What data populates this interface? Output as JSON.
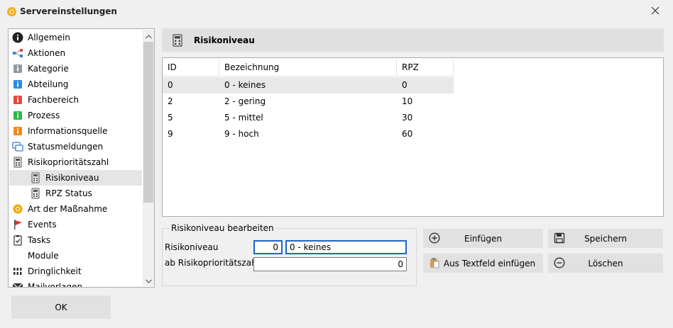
{
  "window": {
    "title": "Servereinstellungen"
  },
  "nav": {
    "items": [
      {
        "label": "Allgemein",
        "icon": "info-circle-icon",
        "color": "#222222"
      },
      {
        "label": "Aktionen",
        "icon": "workflow-icon",
        "color": "#3b7dd8"
      },
      {
        "label": "Kategorie",
        "icon": "info-tag-icon",
        "color": "#8c9aa3"
      },
      {
        "label": "Abteilung",
        "icon": "info-tag-icon",
        "color": "#2f8be0"
      },
      {
        "label": "Fachbereich",
        "icon": "info-tag-icon",
        "color": "#e5483c"
      },
      {
        "label": "Prozess",
        "icon": "info-tag-icon",
        "color": "#2eb84b"
      },
      {
        "label": "Informationsquelle",
        "icon": "info-tag-icon",
        "color": "#f08a1c"
      },
      {
        "label": "Statusmeldungen",
        "icon": "chat-bubbles-icon",
        "color": "#3b7dd8"
      },
      {
        "label": "Risikoprioritätszahl",
        "icon": "calculator-icon",
        "color": "#555555"
      },
      {
        "label": "Risikoniveau",
        "icon": "calculator-icon",
        "color": "#555555"
      },
      {
        "label": "RPZ Status",
        "icon": "calculator-icon",
        "color": "#555555"
      },
      {
        "label": "Art der Maßnahme",
        "icon": "gear-sun-icon",
        "color": "#f2a900"
      },
      {
        "label": "Events",
        "icon": "flag-icon",
        "color": "#e03030"
      },
      {
        "label": "Tasks",
        "icon": "clipboard-check-icon",
        "color": "#333333"
      },
      {
        "label": "Module",
        "icon": "",
        "color": ""
      },
      {
        "label": "Dringlichkeit",
        "icon": "binary-icon",
        "color": "#333333"
      },
      {
        "label": "Mailvorlagen",
        "icon": "envelope-icon",
        "color": "#333333"
      }
    ]
  },
  "panel": {
    "title": "Risikoniveau"
  },
  "table": {
    "columns": [
      "ID",
      "Bezeichnung",
      "RPZ"
    ],
    "rows": [
      {
        "id": "0",
        "name": "0 - keines",
        "rpz": "0"
      },
      {
        "id": "2",
        "name": "2 - gering",
        "rpz": "10"
      },
      {
        "id": "5",
        "name": "5 - mittel",
        "rpz": "30"
      },
      {
        "id": "9",
        "name": "9 - hoch",
        "rpz": "60"
      }
    ]
  },
  "edit": {
    "legend": "Risikoniveau bearbeiten",
    "label_level": "Risikoniveau",
    "label_threshold": "ab Risikoprioritätszahl",
    "level_id": "0",
    "level_name": "0 - keines",
    "threshold": "0"
  },
  "buttons": {
    "insert": "Einfügen",
    "save": "Speichern",
    "paste": "Aus Textfeld einfügen",
    "delete": "Löschen",
    "ok": "OK"
  },
  "colors": {
    "accent": "#1e64c8",
    "selection": "#e5e5e5",
    "header_bg": "#e0e0e0"
  }
}
